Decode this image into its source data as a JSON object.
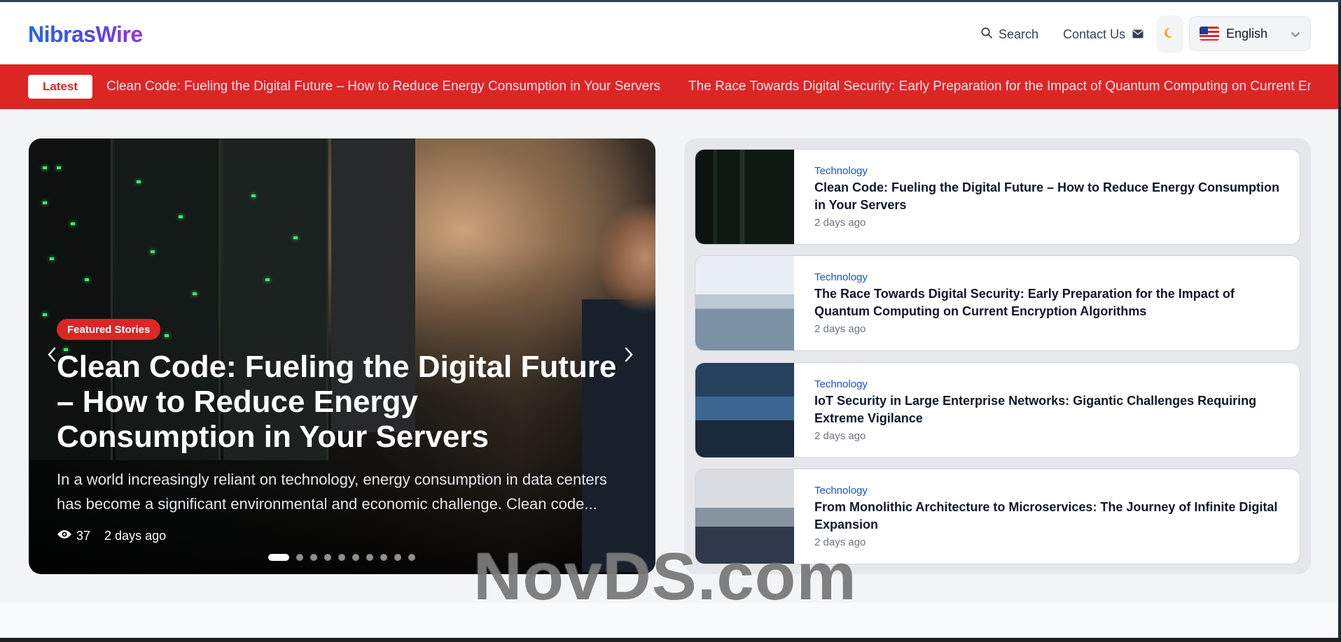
{
  "header": {
    "logo": "NibrasWire",
    "search_label": "Search",
    "contact_label": "Contact Us",
    "language": "English"
  },
  "ticker": {
    "badge": "Latest",
    "items": [
      "Clean Code: Fueling the Digital Future – How to Reduce Energy Consumption in Your Servers",
      "The Race Towards Digital Security: Early Preparation for the Impact of Quantum Computing on Current Encryption Algorithms"
    ]
  },
  "hero": {
    "badge": "Featured Stories",
    "title": "Clean Code: Fueling the Digital Future – How to Reduce Energy Consumption in Your Servers",
    "excerpt": "In a world increasingly reliant on technology, energy consumption in data centers has become a significant environmental and economic challenge. Clean code...",
    "views": "37",
    "time": "2 days ago",
    "slide_count": 10,
    "active_slide": 1
  },
  "side_articles": [
    {
      "category": "Technology",
      "title": "Clean Code: Fueling the Digital Future – How to Reduce Energy Consumption in Your Servers",
      "time": "2 days ago"
    },
    {
      "category": "Technology",
      "title": "The Race Towards Digital Security: Early Preparation for the Impact of Quantum Computing on Current Encryption Algorithms",
      "time": "2 days ago"
    },
    {
      "category": "Technology",
      "title": "IoT Security in Large Enterprise Networks: Gigantic Challenges Requiring Extreme Vigilance",
      "time": "2 days ago"
    },
    {
      "category": "Technology",
      "title": "From Monolithic Architecture to Microservices: The Journey of Infinite Digital Expansion",
      "time": "2 days ago"
    }
  ],
  "watermark": "NovDS.com",
  "colors": {
    "brand_blue": "#2563eb",
    "brand_purple": "#9333ea",
    "ticker_red": "#dc2626",
    "moon_orange": "#f59e0b"
  },
  "icons": {
    "search": "search-icon",
    "contact": "envelope-icon",
    "theme": "moon-icon",
    "flag": "us-flag-icon",
    "dropdown": "chevron-down-icon",
    "views": "eye-icon",
    "prev": "chevron-left-icon",
    "next": "chevron-right-icon"
  }
}
